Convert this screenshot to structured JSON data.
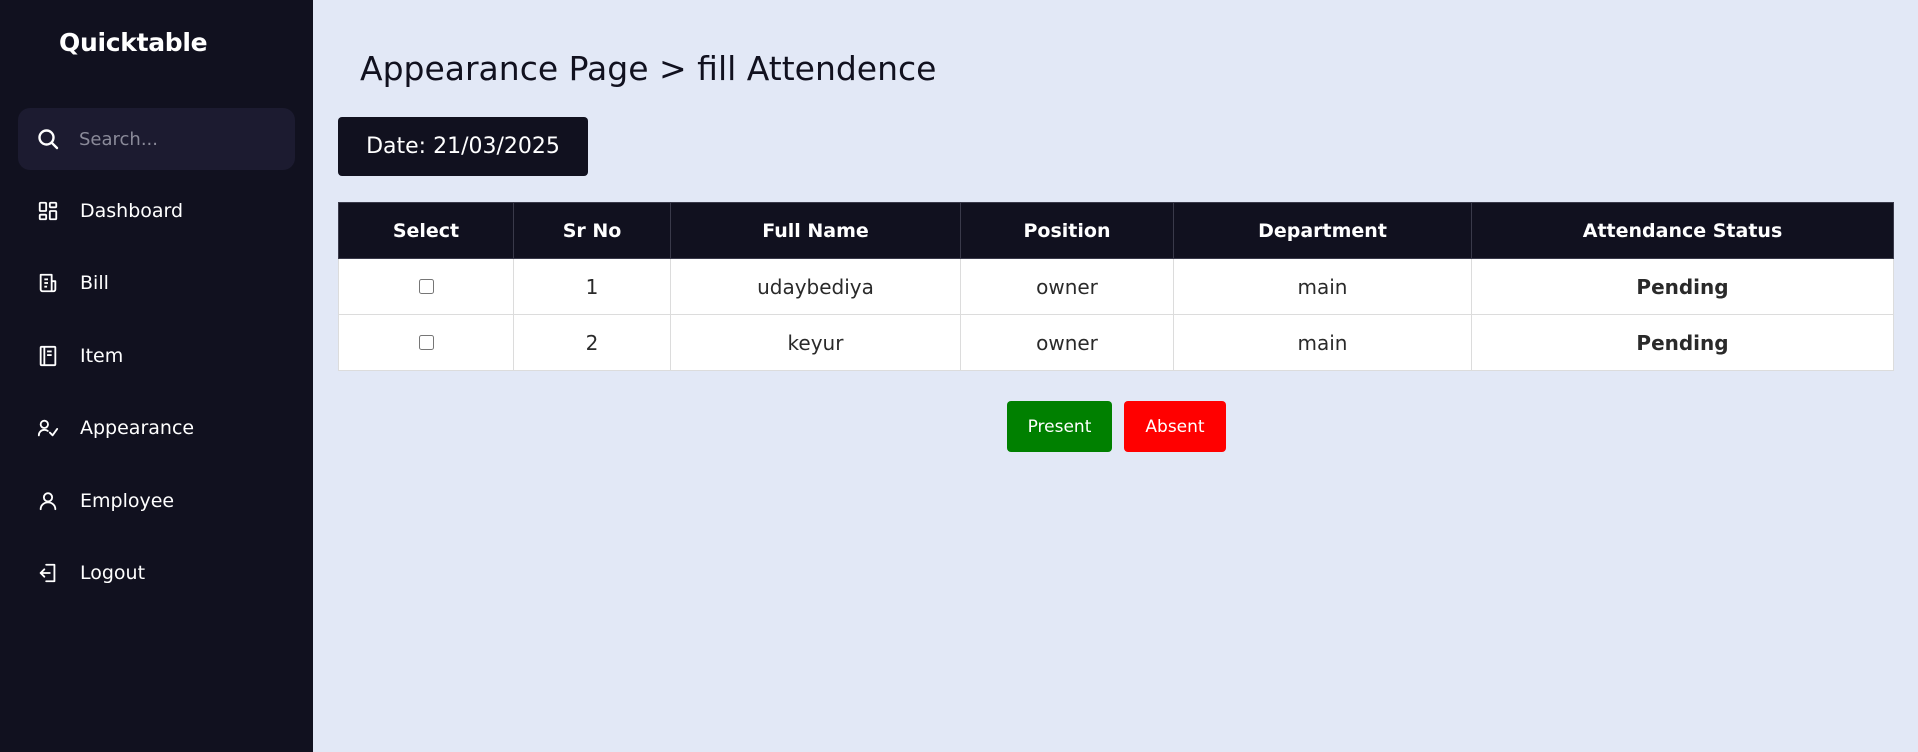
{
  "app": {
    "brand": "Quicktable"
  },
  "search": {
    "placeholder": "Search..."
  },
  "sidebar": {
    "items": [
      {
        "label": "Dashboard",
        "icon": "dashboard-grid-icon"
      },
      {
        "label": "Bill",
        "icon": "bill-icon"
      },
      {
        "label": "Item",
        "icon": "item-book-icon"
      },
      {
        "label": "Appearance",
        "icon": "user-check-icon"
      },
      {
        "label": "Employee",
        "icon": "user-icon"
      },
      {
        "label": "Logout",
        "icon": "logout-icon"
      }
    ]
  },
  "page": {
    "title": "Appearance Page > fill Attendence",
    "date_label": "Date: 21/03/2025"
  },
  "table": {
    "columns": [
      "Select",
      "Sr No",
      "Full Name",
      "Position",
      "Department",
      "Attendance Status"
    ],
    "rows": [
      {
        "sr_no": "1",
        "full_name": "udaybediya",
        "position": "owner",
        "department": "main",
        "status": "Pending",
        "selected": false
      },
      {
        "sr_no": "2",
        "full_name": "keyur",
        "position": "owner",
        "department": "main",
        "status": "Pending",
        "selected": false
      }
    ]
  },
  "actions": {
    "present_label": "Present",
    "absent_label": "Absent"
  },
  "colors": {
    "sidebar_bg": "#11111f",
    "page_bg": "#e2e8f6",
    "pending": "#f5a623",
    "present": "#008000",
    "absent": "#ff0000"
  }
}
